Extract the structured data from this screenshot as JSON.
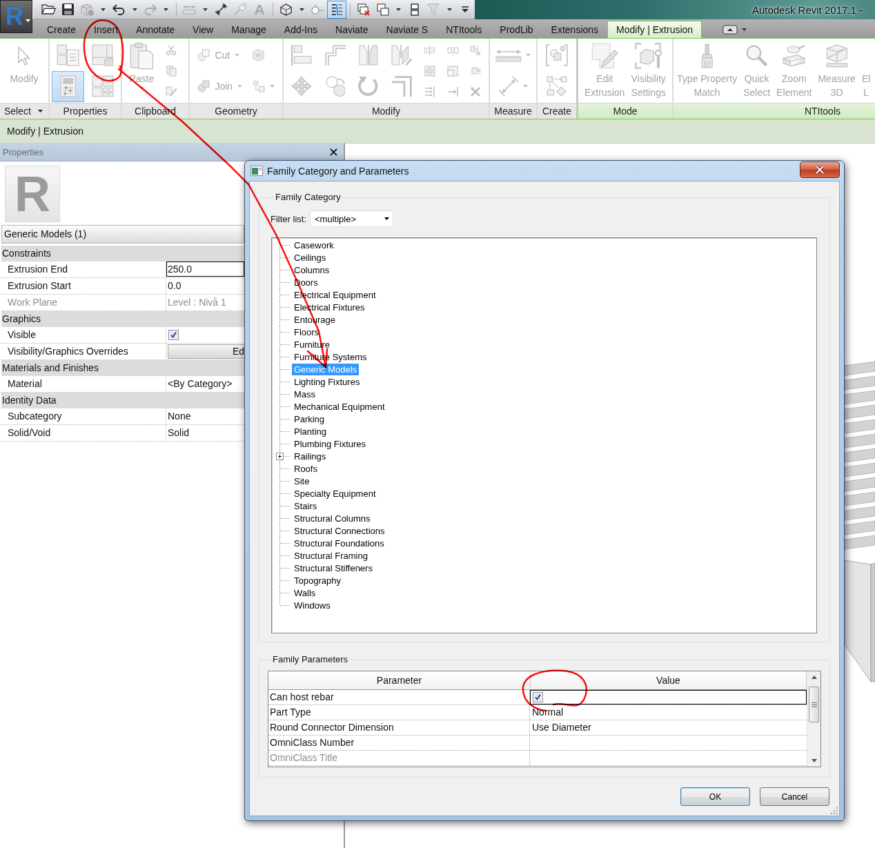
{
  "app_button": {
    "letter": "R"
  },
  "quick_access": [
    {
      "items": [
        {
          "dropdown": false,
          "selected": false,
          "disabled": false
        },
        {
          "dropdown": false,
          "selected": false,
          "disabled": false
        },
        {
          "dropdown": true,
          "selected": false,
          "disabled": true
        },
        {
          "dropdown": true,
          "selected": false,
          "disabled": false
        },
        {
          "dropdown": true,
          "selected": false,
          "disabled": true
        }
      ]
    },
    {
      "items": [
        {
          "dropdown": true,
          "selected": false,
          "disabled": true
        },
        {
          "dropdown": false,
          "selected": false,
          "disabled": false
        },
        {
          "dropdown": false,
          "selected": false,
          "disabled": true
        },
        {
          "glyph": "A",
          "dropdown": false,
          "selected": false,
          "disabled": true
        }
      ]
    },
    {
      "items": [
        {
          "dropdown": true,
          "selected": false,
          "disabled": false
        },
        {
          "dropdown": false,
          "selected": false,
          "disabled": true
        },
        {
          "dropdown": false,
          "selected": true,
          "disabled": false
        }
      ]
    },
    {
      "items": [
        {
          "dropdown": false,
          "selected": false,
          "disabled": false
        },
        {
          "dropdown": true,
          "selected": false,
          "disabled": false
        },
        {
          "dropdown": false,
          "selected": false,
          "disabled": false
        },
        {
          "dropdown": true,
          "selected": false,
          "disabled": true
        },
        {
          "dropdown": false,
          "selected": false,
          "disabled": false
        }
      ]
    }
  ],
  "title": "Autodesk Revit 2017.1 -",
  "tabs": [
    {
      "label": "Create",
      "selected": false
    },
    {
      "label": "Insert",
      "selected": false
    },
    {
      "label": "Annotate",
      "selected": false
    },
    {
      "label": "View",
      "selected": false
    },
    {
      "label": "Manage",
      "selected": false
    },
    {
      "label": "Add-Ins",
      "selected": false
    },
    {
      "label": "Naviate",
      "selected": false
    },
    {
      "label": "Naviate S",
      "selected": false
    },
    {
      "label": "NTItools",
      "selected": false
    },
    {
      "label": "ProdLib",
      "selected": false
    },
    {
      "label": "Extensions",
      "selected": false
    },
    {
      "label": "Modify | Extrusion",
      "selected": true
    }
  ],
  "ribbon": {
    "disabled": true,
    "panels": [
      {
        "title": "Select",
        "dropdown": true,
        "contextual": false,
        "items": [
          {
            "kind": "large",
            "lines": [
              "Modify"
            ],
            "dropdown": false
          }
        ]
      },
      {
        "title": "Properties",
        "dropdown": false,
        "contextual": false,
        "items": [
          {
            "kind": "medium",
            "selected": false,
            "dropdown": false
          },
          {
            "kind": "medium",
            "selected": true,
            "dropdown": false
          },
          {
            "kind": "medium",
            "selected": false,
            "dropdown": false
          },
          {
            "kind": "medium",
            "selected": false,
            "dropdown": false
          }
        ]
      },
      {
        "title": "Clipboard",
        "dropdown": false,
        "contextual": false,
        "items": [
          {
            "kind": "large",
            "lines": [
              "Paste"
            ],
            "dropdown": true
          },
          {
            "kind": "tiny",
            "dropdown": false
          },
          {
            "kind": "tiny",
            "dropdown": false
          },
          {
            "kind": "tiny",
            "dropdown": false
          }
        ]
      },
      {
        "title": "Geometry",
        "dropdown": false,
        "contextual": false,
        "items": [
          {
            "kind": "small",
            "label": "Cut",
            "dropdown": true
          },
          {
            "kind": "small",
            "label": "Join",
            "dropdown": true
          },
          {
            "kind": "small",
            "dropdown": false
          },
          {
            "kind": "small",
            "dropdown": true
          }
        ]
      },
      {
        "title": "Modify",
        "dropdown": false,
        "contextual": false,
        "items": [
          {
            "kind": "medium",
            "dropdown": false
          },
          {
            "kind": "medium",
            "dropdown": false
          },
          {
            "kind": "medium",
            "dropdown": false
          },
          {
            "kind": "medium",
            "dropdown": false
          },
          {
            "kind": "medium",
            "dropdown": false
          },
          {
            "kind": "medium",
            "dropdown": false
          },
          {
            "kind": "medium",
            "dropdown": false
          },
          {
            "kind": "medium",
            "dropdown": false
          },
          {
            "kind": "tiny",
            "dropdown": false
          },
          {
            "kind": "tiny",
            "dropdown": false
          },
          {
            "kind": "tiny",
            "dropdown": false
          },
          {
            "kind": "tiny",
            "dropdown": false
          },
          {
            "kind": "tiny",
            "dropdown": false
          },
          {
            "kind": "tiny",
            "dropdown": false
          },
          {
            "kind": "tiny",
            "dropdown": false
          },
          {
            "kind": "tiny",
            "dropdown": false
          },
          {
            "kind": "tiny",
            "dropdown": false
          }
        ]
      },
      {
        "title": "Measure",
        "dropdown": false,
        "contextual": false,
        "items": [
          {
            "kind": "medium",
            "dropdown": true
          },
          {
            "kind": "medium",
            "dropdown": true
          }
        ]
      },
      {
        "title": "Create",
        "dropdown": false,
        "contextual": false,
        "items": [
          {
            "kind": "medium",
            "dropdown": false
          },
          {
            "kind": "medium",
            "dropdown": false
          }
        ]
      },
      {
        "title": "Mode",
        "dropdown": false,
        "contextual": true,
        "items": [
          {
            "kind": "large",
            "lines": [
              "Edit",
              "Extrusion"
            ],
            "dropdown": false
          },
          {
            "kind": "large",
            "lines": [
              "Visibility",
              "Settings"
            ],
            "dropdown": false
          }
        ]
      },
      {
        "title": "NTItools",
        "dropdown": false,
        "contextual": true,
        "items": [
          {
            "kind": "large",
            "lines": [
              "Type Property",
              "Match"
            ],
            "dropdown": false
          },
          {
            "kind": "large",
            "lines": [
              "Quick",
              "Select"
            ],
            "dropdown": false
          },
          {
            "kind": "large",
            "lines": [
              "Zoom",
              "Element"
            ],
            "dropdown": false
          },
          {
            "kind": "large",
            "lines": [
              "Measure",
              "3D"
            ],
            "dropdown": false
          },
          {
            "kind": "large",
            "lines": [
              "El",
              "L"
            ],
            "dropdown": false
          }
        ]
      }
    ]
  },
  "context_bar": "Modify | Extrusion",
  "properties": {
    "title": "Properties",
    "type_image": {
      "letter": "R"
    },
    "type_selector": "Generic Models (1)",
    "groups": [
      {
        "name": "Constraints",
        "rows": [
          {
            "label": "Extrusion End",
            "kind": "input",
            "value": "250.0",
            "disabled": false
          },
          {
            "label": "Extrusion Start",
            "kind": "text",
            "value": "0.0",
            "disabled": false
          },
          {
            "label": "Work Plane",
            "kind": "text",
            "value": "Level : Nivå 1",
            "disabled": true
          }
        ]
      },
      {
        "name": "Graphics",
        "rows": [
          {
            "label": "Visible",
            "kind": "checkbox",
            "checked": true,
            "disabled": false
          },
          {
            "label": "Visibility/Graphics Overrides",
            "kind": "button",
            "value": "Ed",
            "disabled": false
          }
        ]
      },
      {
        "name": "Materials and Finishes",
        "rows": [
          {
            "label": "Material",
            "kind": "text",
            "value": "<By Category>",
            "disabled": false
          }
        ]
      },
      {
        "name": "Identity Data",
        "rows": [
          {
            "label": "Subcategory",
            "kind": "text",
            "value": "None",
            "disabled": false
          },
          {
            "label": "Solid/Void",
            "kind": "text",
            "value": "Solid",
            "disabled": false
          }
        ]
      }
    ]
  },
  "dialog": {
    "title": "Family Category and Parameters",
    "family_category": {
      "title": "Family Category",
      "filter_label": "Filter list:",
      "filter_value": "<multiple>",
      "categories": [
        {
          "label": "Casework",
          "kind": "leaf",
          "selected": false
        },
        {
          "label": "Ceilings",
          "kind": "leaf",
          "selected": false
        },
        {
          "label": "Columns",
          "kind": "leaf",
          "selected": false
        },
        {
          "label": "Doors",
          "kind": "leaf",
          "selected": false
        },
        {
          "label": "Electrical Equipment",
          "kind": "leaf",
          "selected": false
        },
        {
          "label": "Electrical Fixtures",
          "kind": "leaf",
          "selected": false
        },
        {
          "label": "Entourage",
          "kind": "leaf",
          "selected": false
        },
        {
          "label": "Floors",
          "kind": "leaf",
          "selected": false
        },
        {
          "label": "Furniture",
          "kind": "leaf",
          "selected": false
        },
        {
          "label": "Furniture Systems",
          "kind": "leaf",
          "selected": false
        },
        {
          "label": "Generic Models",
          "kind": "leaf",
          "selected": true
        },
        {
          "label": "Lighting Fixtures",
          "kind": "leaf",
          "selected": false
        },
        {
          "label": "Mass",
          "kind": "leaf",
          "selected": false
        },
        {
          "label": "Mechanical Equipment",
          "kind": "leaf",
          "selected": false
        },
        {
          "label": "Parking",
          "kind": "leaf",
          "selected": false
        },
        {
          "label": "Planting",
          "kind": "leaf",
          "selected": false
        },
        {
          "label": "Plumbing Fixtures",
          "kind": "leaf",
          "selected": false
        },
        {
          "label": "Railings",
          "kind": "group",
          "expanded": false,
          "selected": false
        },
        {
          "label": "Roofs",
          "kind": "leaf",
          "selected": false
        },
        {
          "label": "Site",
          "kind": "leaf",
          "selected": false
        },
        {
          "label": "Specialty Equipment",
          "kind": "leaf",
          "selected": false
        },
        {
          "label": "Stairs",
          "kind": "leaf",
          "selected": false
        },
        {
          "label": "Structural Columns",
          "kind": "leaf",
          "selected": false
        },
        {
          "label": "Structural Connections",
          "kind": "leaf",
          "selected": false
        },
        {
          "label": "Structural Foundations",
          "kind": "leaf",
          "selected": false
        },
        {
          "label": "Structural Framing",
          "kind": "leaf",
          "selected": false
        },
        {
          "label": "Structural Stiffeners",
          "kind": "leaf",
          "selected": false
        },
        {
          "label": "Topography",
          "kind": "leaf",
          "selected": false
        },
        {
          "label": "Walls",
          "kind": "leaf",
          "selected": false
        },
        {
          "label": "Windows",
          "kind": "leaf",
          "selected": false
        }
      ]
    },
    "family_parameters": {
      "title": "Family Parameters",
      "columns": [
        "Parameter",
        "Value"
      ],
      "rows": [
        {
          "name": "Can host rebar",
          "kind": "checkbox",
          "checked": true,
          "focused": true,
          "disabled": false
        },
        {
          "name": "Part Type",
          "kind": "text",
          "value": "Normal",
          "focused": false,
          "disabled": false
        },
        {
          "name": "Round Connector Dimension",
          "kind": "text",
          "value": "Use Diameter",
          "focused": false,
          "disabled": false
        },
        {
          "name": "OmniClass Number",
          "kind": "text",
          "focused": false,
          "disabled": false
        },
        {
          "name": "OmniClass Title",
          "kind": "text",
          "focused": false,
          "disabled": true
        }
      ]
    },
    "buttons": [
      {
        "label": "OK",
        "default": true
      },
      {
        "label": "Cancel",
        "default": false
      }
    ]
  },
  "annotations": [
    {
      "kind": "circle"
    },
    {
      "kind": "arrow"
    },
    {
      "kind": "circle"
    }
  ]
}
